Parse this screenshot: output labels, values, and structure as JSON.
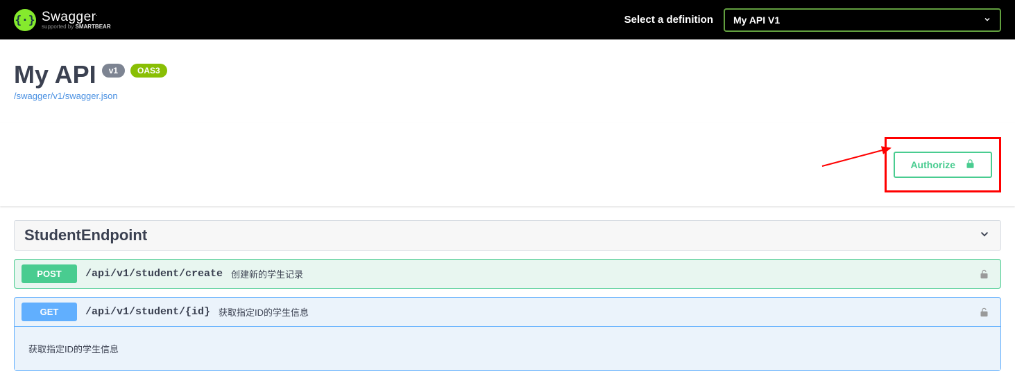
{
  "topbar": {
    "logo_main": "Swagger",
    "logo_sub_prefix": "supported by ",
    "logo_sub_brand": "SMARTBEAR",
    "select_label": "Select a definition",
    "selected_definition": "My API V1"
  },
  "info": {
    "title": "My API",
    "version": "v1",
    "oas_badge": "OAS3",
    "spec_url": "/swagger/v1/swagger.json"
  },
  "auth": {
    "button_label": "Authorize"
  },
  "tags": [
    {
      "name": "StudentEndpoint"
    }
  ],
  "operations": {
    "post_student_create": {
      "method": "POST",
      "path": "/api/v1/student/create",
      "summary": "创建新的学生记录"
    },
    "get_student_by_id": {
      "method": "GET",
      "path": "/api/v1/student/{id}",
      "summary": "获取指定ID的学生信息",
      "description": "获取指定ID的学生信息"
    }
  }
}
